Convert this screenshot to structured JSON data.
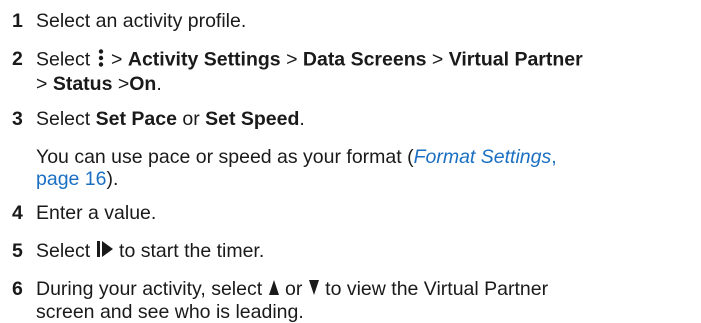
{
  "steps": [
    {
      "num": "1",
      "text": "Select an activity profile."
    },
    {
      "num": "2",
      "select": "Select",
      "gt": ">",
      "items": [
        "Activity Settings",
        "Data Screens",
        "Virtual Partner",
        "Status",
        "On"
      ],
      "menu_icon": "vertical-dots-menu-icon"
    },
    {
      "num": "3",
      "select": "Select",
      "opt1": "Set Pace",
      "or": "or",
      "opt2": "Set Speed",
      "end": "."
    },
    {
      "num": "4",
      "text": "Enter a value."
    },
    {
      "num": "5",
      "select": "Select",
      "rest": "to start the timer.",
      "icon": "start-stop-icon"
    },
    {
      "num": "6",
      "pre": "During your activity, select",
      "or": "or",
      "rest_line1": "to view the Virtual Partner",
      "rest_line2": "screen and see who is leading.",
      "up_icon": "up-arrow-icon",
      "down_icon": "down-arrow-icon"
    }
  ],
  "note": {
    "line1_pre": "You can use pace or speed as your format (",
    "link_title": "Format Settings",
    "link_comma": ",",
    "link_page": "page 16",
    "line2_post": ")."
  }
}
